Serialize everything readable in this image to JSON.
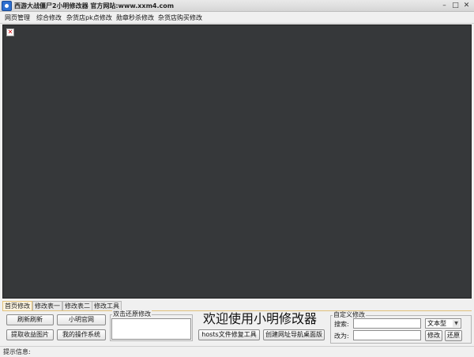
{
  "window": {
    "title": "西游大战僵尸2小明修改器 官方网站:www.xxm4.com",
    "min_glyph": "–",
    "max_glyph": "□",
    "close_glyph": "✕"
  },
  "menu": [
    "网页管理",
    "综合修改",
    "杂货店pk点修改",
    "勋章秒杀修改",
    "杂货店购买修改"
  ],
  "browser": {
    "broken_image_glyph": "✕"
  },
  "tabs": [
    "首页修改",
    "修改表一",
    "修改表二",
    "修改工具"
  ],
  "active_tab": 0,
  "buttons": {
    "refresh": "刷新刷新",
    "official_site": "小明官网",
    "extract_image": "提取收益图片",
    "my_system": "我的操作系统",
    "hosts_repair": "hosts文件修复工具",
    "create_nav": "创建网址导航桌面版",
    "modify": "修改",
    "restore": "还原"
  },
  "dblclick_group": {
    "label": "双击还原修改"
  },
  "welcome_text": "欢迎使用小明修改器",
  "custom_group": {
    "label": "自定义修改",
    "search_label": "搜索:",
    "change_label": "改为:",
    "search_value": "",
    "change_value": "",
    "type_selected": "文本型"
  },
  "status": {
    "text": "提示信息:"
  }
}
